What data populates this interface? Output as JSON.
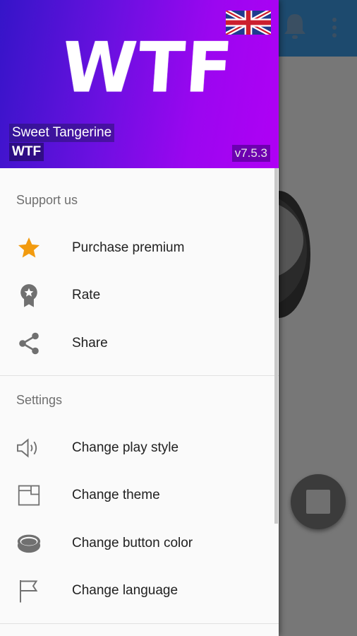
{
  "header": {
    "logo_text": "WTF",
    "app_name": "Sweet Tangerine",
    "subtitle": "WTF",
    "version": "v7.5.3",
    "language_flag": "uk-flag-icon"
  },
  "sections": [
    {
      "title": "Support us",
      "items": [
        {
          "label": "Purchase premium",
          "icon": "star-icon"
        },
        {
          "label": "Rate",
          "icon": "award-badge-icon"
        },
        {
          "label": "Share",
          "icon": "share-icon"
        }
      ]
    },
    {
      "title": "Settings",
      "items": [
        {
          "label": "Change play style",
          "icon": "speaker-icon"
        },
        {
          "label": "Change theme",
          "icon": "theme-icon"
        },
        {
          "label": "Change button color",
          "icon": "button-color-icon"
        },
        {
          "label": "Change language",
          "icon": "flag-icon"
        }
      ]
    }
  ],
  "colors": {
    "header_gradient_start": "#3515c8",
    "header_gradient_end": "#b000f5",
    "star": "#f29b0f",
    "toolbar": "#1d4a6e"
  },
  "background": {
    "toolbar_icons": [
      "bell-icon",
      "overflow-menu-icon"
    ],
    "fab_icon": "stop-icon"
  }
}
